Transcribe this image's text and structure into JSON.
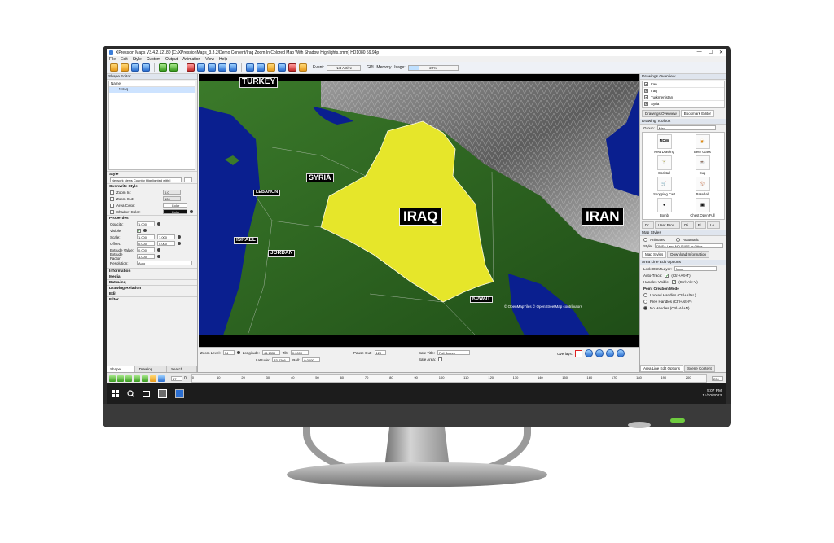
{
  "window": {
    "title": "XPression Maps V3.4.2.12180 [C:/XPressionMaps_3.3.2/Demo Content/Iraq Zoom In Colored Map With Shadow Highlights.xmm] HD1080 59.94p",
    "controls": [
      "—",
      "☐",
      "✕"
    ]
  },
  "menu": [
    "File",
    "Edit",
    "Style",
    "Custom",
    "Output",
    "Animation",
    "View",
    "Help"
  ],
  "toolbar": {
    "event_label": "Event:",
    "event_value": "Not Active",
    "gpu_label": "GPU Memory Usage:",
    "gpu_value": "22%",
    "gpu_fraction": 0.22
  },
  "shape_editor": {
    "title": "Shape Editor",
    "column_name": "Name",
    "rows": [
      "L 1 Iraq"
    ],
    "style_section": "Style",
    "style_value": "Network News Country Highlighted with I",
    "override_section": "Overwrite Style",
    "overrides": [
      {
        "label": "Zoom In:",
        "value": "0.0"
      },
      {
        "label": "Zoom Out:",
        "value": "100"
      },
      {
        "label": "Area Color:",
        "value": "Color"
      },
      {
        "label": "Shadow Color:",
        "value": "Color"
      }
    ],
    "properties_section": "Properties",
    "properties": [
      {
        "label": "Opacity:",
        "value": "1.000"
      },
      {
        "label": "Visible:",
        "value": "✔"
      },
      {
        "label": "Scale:",
        "value": "1.000",
        "value2": "1.000"
      },
      {
        "label": "Offset:",
        "value": "0.000",
        "value2": "0.000"
      },
      {
        "label": "Extrude Value:",
        "value": "0.000"
      },
      {
        "label": "Extrude Factor:",
        "value": "1.000"
      },
      {
        "label": "Resolution:",
        "value": "Auto"
      }
    ],
    "collapsed_sections": [
      "Information",
      "Media",
      "DataLinq",
      "Drawing Relation",
      "Edit",
      "Filter"
    ],
    "bottom_tabs": [
      "Shape Editor",
      "Drawing Editor",
      "Search Editor"
    ]
  },
  "map": {
    "labels": {
      "turkey": "TURKEY",
      "syria": "SYRIA",
      "lebanon": "LEBANON",
      "iraq": "IRAQ",
      "iran": "IRAN",
      "israel": "ISRAEL",
      "jordan": "JORDAN",
      "kuwait": "KUWAIT"
    },
    "attribution": "© OpenMapTiles © OpenStreetMap contributors",
    "highlight_color": "#e6e62a"
  },
  "map_controls": {
    "zoom_label": "Zoom Level:",
    "zoom_value": "34",
    "longitude_label": "Longitude:",
    "longitude_value": "44.1339",
    "latitude_label": "Latitude:",
    "latitude_value": "33.4266",
    "tilt_label": "Tilt:",
    "tilt_value": "0.0000",
    "roll_label": "Roll:",
    "roll_value": "0.0000",
    "pause_label": "Pause Out:",
    "pause_value": "120",
    "safe_title_label": "Safe Title:",
    "safe_title_value": "Full Screen",
    "safe_area_label": "Safe Area:",
    "overlays_label": "Overlays:"
  },
  "drawings_overview": {
    "title": "Drawings Overview",
    "items": [
      "Iran",
      "Iraq",
      "Turkmenistan",
      "Syria"
    ],
    "tabs": [
      "Drawings Overview",
      "Bookmark Editor"
    ]
  },
  "drawing_toolbox": {
    "title": "Drawing Toolbox",
    "group_label": "Group:",
    "group_value": "Misc",
    "tools": [
      {
        "label": "New Drawing",
        "glyph": "NEW"
      },
      {
        "label": "Beer Glass",
        "glyph": "🍺"
      },
      {
        "label": "Cocktail",
        "glyph": "🍸"
      },
      {
        "label": "Cup",
        "glyph": "☕"
      },
      {
        "label": "Shopping Cart",
        "glyph": "🛒"
      },
      {
        "label": "Baseball",
        "glyph": "⚾"
      },
      {
        "label": "Bomb",
        "glyph": "●"
      },
      {
        "label": "Chest Open Full",
        "glyph": "▣"
      }
    ],
    "subtabs": [
      "Dr..",
      "User Prod..",
      "Oli..",
      "Fl..",
      "Lo.."
    ]
  },
  "map_styles": {
    "title": "Map Styles",
    "animated": "Animated",
    "automatic": "Automatic",
    "style_label": "Style:",
    "style_value": "DMEA Land NO SUBS or Cities",
    "tabs": [
      "Map Styles",
      "Download Information"
    ]
  },
  "area_line": {
    "title": "Area Line Edit Options",
    "lock_label": "Lock OSM Layer:",
    "lock_value": "None",
    "autotrace_label": "Auto-Trace:",
    "autotrace_value": "(Ctrl+Alt+T)",
    "handles_label": "Handles Visible:",
    "handles_value": "(Ctrl+Alt+V)",
    "point_creation": "Point Creation Mode",
    "modes": [
      "Locked Handles (Ctrl+Alt+L)",
      "Free Handles (Ctrl+Alt+F)",
      "No Handles (Ctrl+Alt+N)"
    ],
    "tabs": [
      "Area Line Edit Options",
      "Scene Content"
    ]
  },
  "timeline": {
    "frame_value": "67",
    "start": "0",
    "end_value": "200",
    "ticks": [
      "0",
      "10",
      "20",
      "30",
      "40",
      "50",
      "60",
      "70",
      "80",
      "90",
      "100",
      "110",
      "120",
      "130",
      "140",
      "150",
      "160",
      "170",
      "180",
      "190",
      "200"
    ]
  },
  "taskbar": {
    "time": "5:07 PM",
    "date": "11/20/2023"
  }
}
